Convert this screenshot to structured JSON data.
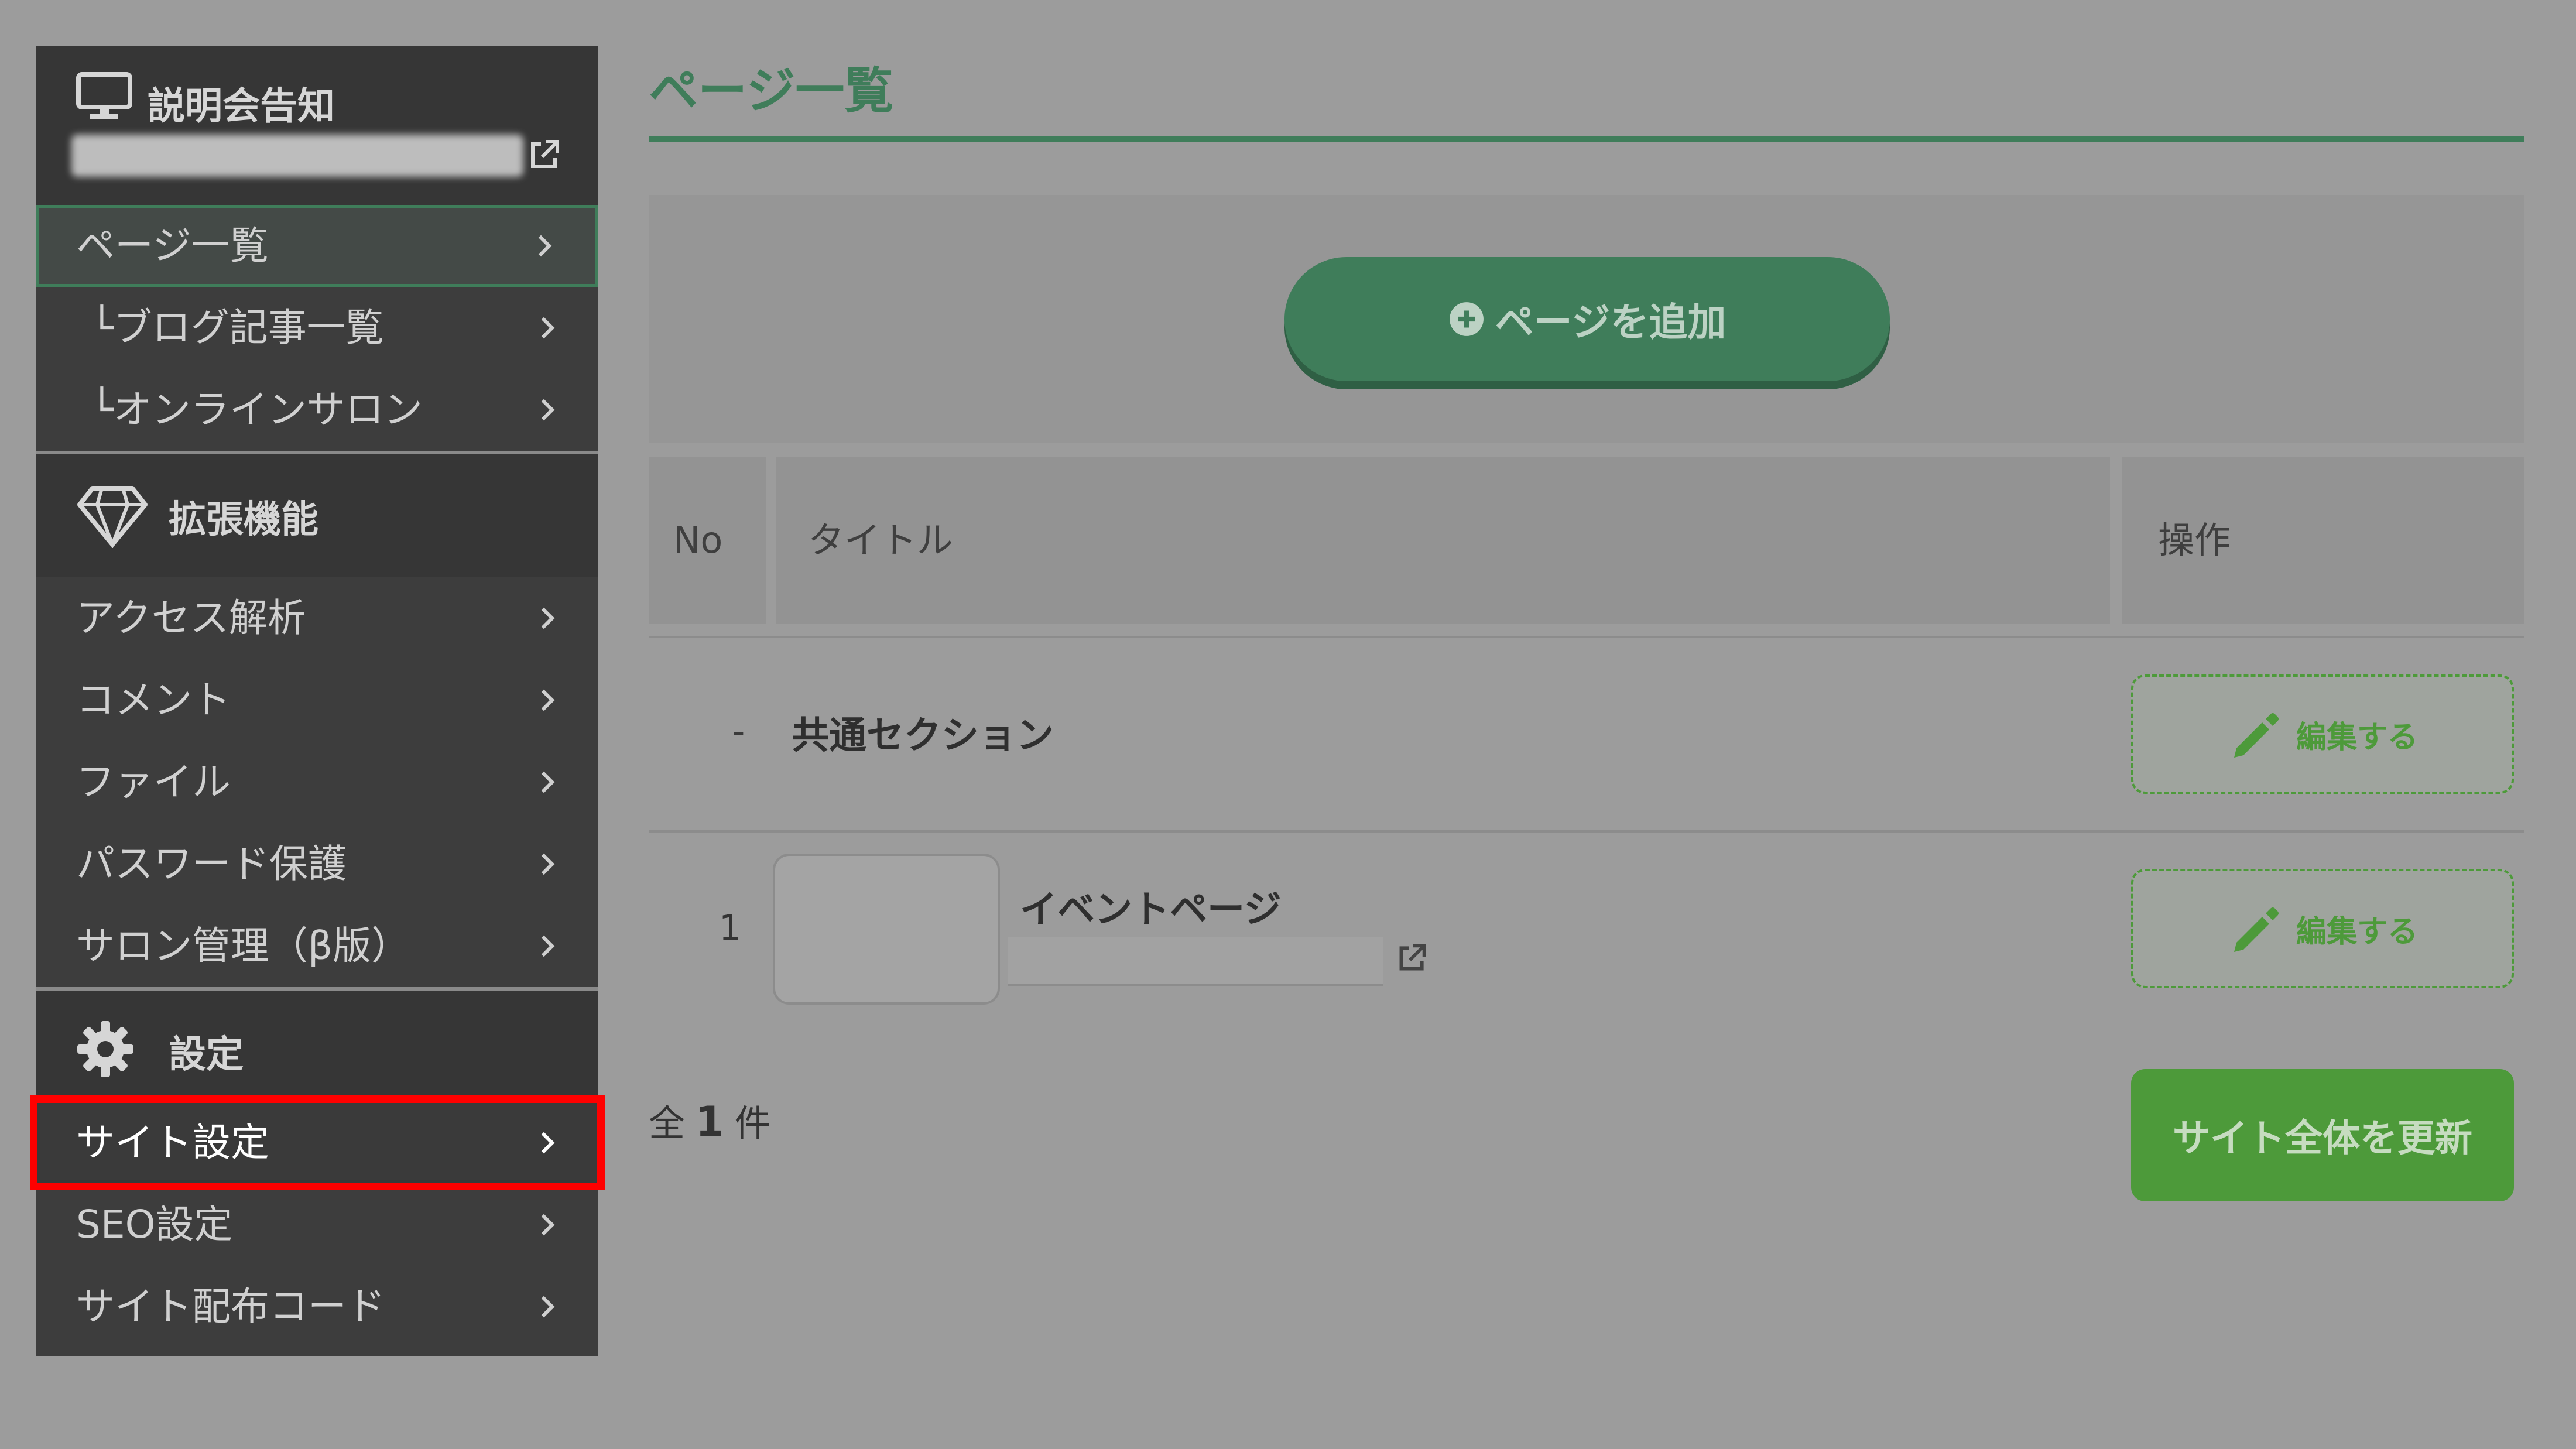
{
  "sidebar": {
    "site_title": "説明会告知",
    "site_items": [
      {
        "label": "ページ一覧"
      },
      {
        "label": "└ブログ記事一覧"
      },
      {
        "label": "└オンラインサロン"
      }
    ],
    "extensions_title": "拡張機能",
    "extension_items": [
      {
        "label": "アクセス解析"
      },
      {
        "label": "コメント"
      },
      {
        "label": "ファイル"
      },
      {
        "label": "パスワード保護"
      },
      {
        "label": "サロン管理（β版）"
      }
    ],
    "settings_title": "設定",
    "settings_items": [
      {
        "label": "サイト設定"
      },
      {
        "label": "SEO設定"
      },
      {
        "label": "サイト配布コード"
      }
    ]
  },
  "main": {
    "page_title": "ページ一覧",
    "add_page_label": "ページを追加",
    "table": {
      "headers": {
        "no": "No",
        "title": "タイトル",
        "actions": "操作"
      },
      "common_row": {
        "no": "-",
        "title": "共通セクション",
        "edit_label": "編集する"
      },
      "rows": [
        {
          "no": "1",
          "title": "イベントページ",
          "edit_label": "編集する"
        }
      ]
    },
    "total": {
      "prefix": "全",
      "count": "1",
      "suffix": "件"
    },
    "update_label": "サイト全体を更新"
  },
  "colors": {
    "accent_green": "#3f7d5a",
    "update_green": "#4d9a3a",
    "highlight_red": "#ff0000"
  }
}
